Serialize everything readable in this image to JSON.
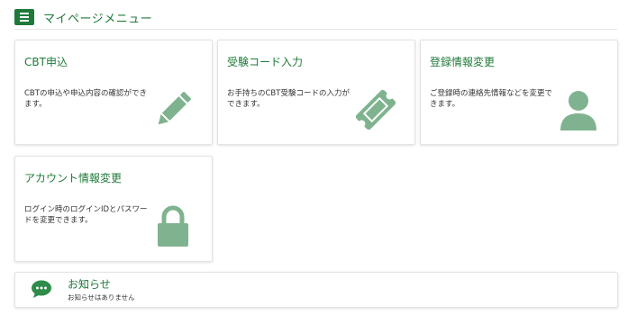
{
  "header": {
    "title": "マイページメニュー"
  },
  "cards": [
    {
      "title": "CBT申込",
      "description": "CBTの申込や申込内容の確認ができます。",
      "icon": "pencil-icon"
    },
    {
      "title": "受験コード入力",
      "description": "お手持ちのCBT受験コードの入力ができます。",
      "icon": "ticket-icon"
    },
    {
      "title": "登録情報変更",
      "description": "ご登録時の連絡先情報などを変更できます。",
      "icon": "user-icon"
    },
    {
      "title": "アカウント情報変更",
      "description": "ログイン時のログインIDとパスワードを変更できます。",
      "icon": "lock-icon"
    }
  ],
  "notice": {
    "title": "お知らせ",
    "text": "お知らせはありません",
    "icon": "chat-bubble-icon"
  },
  "colors": {
    "accent": "#1f7a3a",
    "icon_fill": "#7fb38f",
    "notice_icon": "#2e8b4a"
  }
}
